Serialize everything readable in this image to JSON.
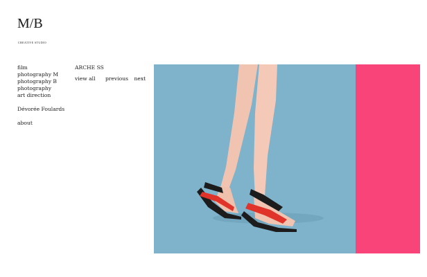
{
  "brand": {
    "logo_text": "M/B",
    "tagline": "CREATIVE STUDIO"
  },
  "nav": {
    "items": [
      "film",
      "photography M",
      "photography B",
      "photography",
      "art direction"
    ],
    "client": "Dévorée Foulards",
    "about": "about"
  },
  "project": {
    "title": "ARCHE SS",
    "view_all": "view all",
    "previous": "previous",
    "next": "next"
  },
  "image": {
    "description_icon": "photo-sandals",
    "colors": {
      "background": "#7fb3cb",
      "accent_panel": "#f94479",
      "sandal_strap": "#e0342a",
      "sandal_sole": "#1c1c1c"
    }
  }
}
